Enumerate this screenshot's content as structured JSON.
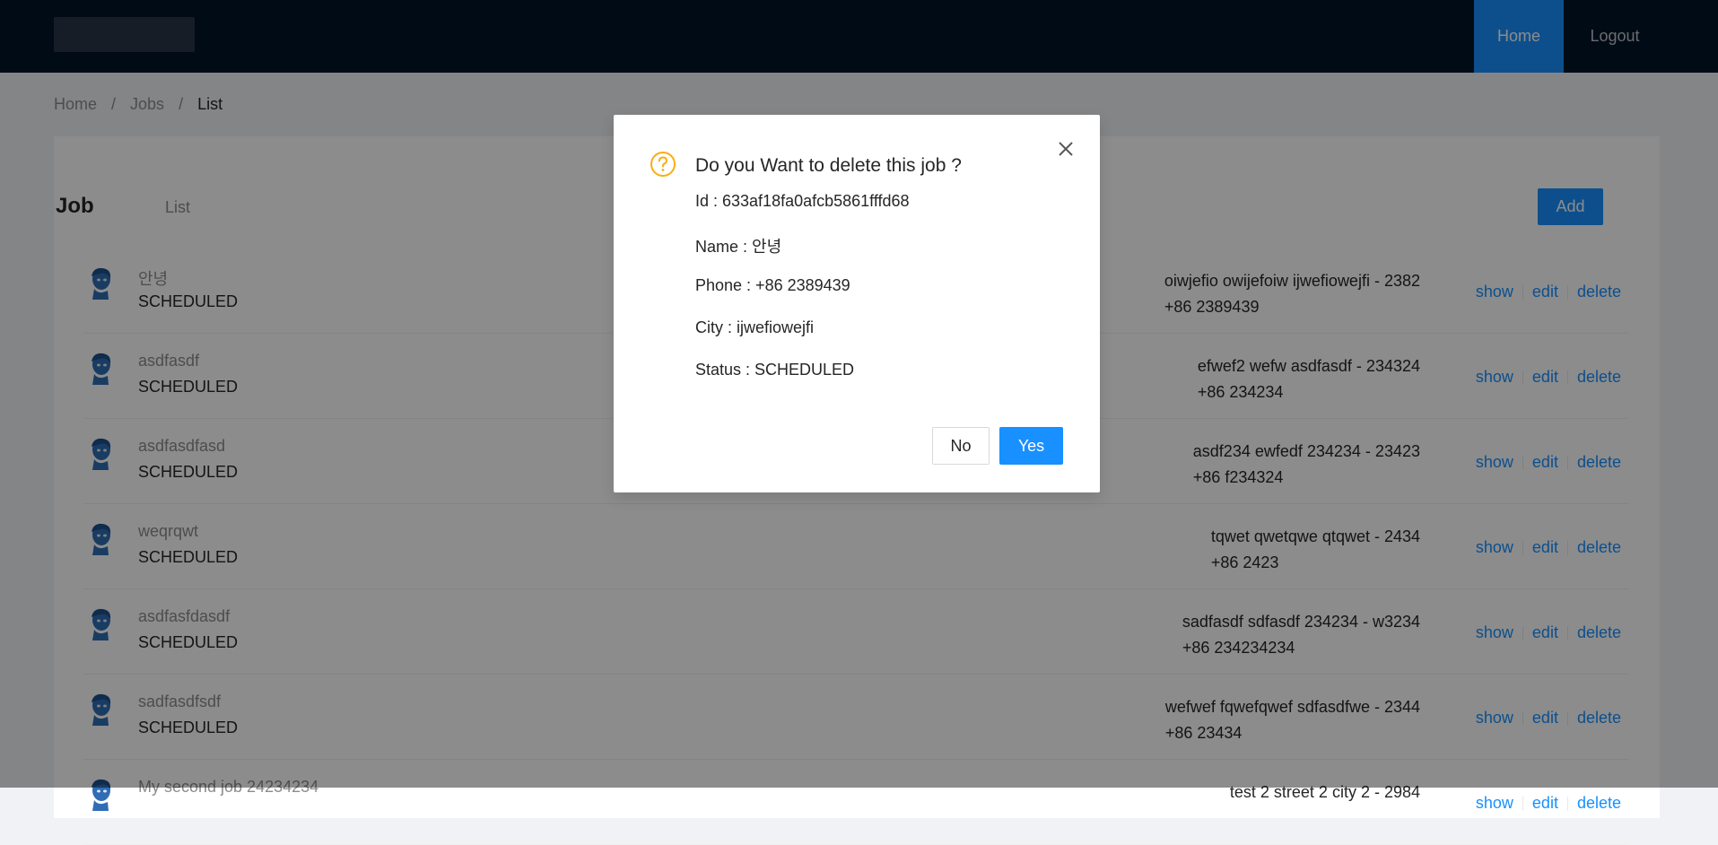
{
  "header": {
    "nav": [
      {
        "label": "Home",
        "active": true
      },
      {
        "label": "Logout",
        "active": false
      }
    ]
  },
  "breadcrumb": [
    "Home",
    "Jobs",
    "List"
  ],
  "page": {
    "title": "Job",
    "subtitle": "List",
    "add_label": "Add"
  },
  "jobs": [
    {
      "name": "안녕",
      "status": "SCHEDULED",
      "address": "oiwjefio owijefoiw ijwefiowejfi - 2382",
      "phone": "+86 2389439"
    },
    {
      "name": "asdfasdf",
      "status": "SCHEDULED",
      "address": "efwef2 wefw asdfasdf - 234324",
      "phone": "+86 234234"
    },
    {
      "name": "asdfasdfasd",
      "status": "SCHEDULED",
      "address": "asdf234 ewfedf 234234 - 23423",
      "phone": "+86 f234324"
    },
    {
      "name": "weqrqwt",
      "status": "SCHEDULED",
      "address": "tqwet qwetqwe qtqwet - 2434",
      "phone": "+86 2423"
    },
    {
      "name": "asdfasfdasdf",
      "status": "SCHEDULED",
      "address": "sadfasdf sdfasdf 234234 - w3234",
      "phone": "+86 234234234"
    },
    {
      "name": "sadfasdfsdf",
      "status": "SCHEDULED",
      "address": "wefwef fqwefqwef sdfasdfwe - 2344",
      "phone": "+86 23434"
    },
    {
      "name": "My second job 24234234",
      "status": "",
      "address": "test 2 street 2 city 2 - 2984",
      "phone": ""
    }
  ],
  "row_actions": {
    "show": "show",
    "edit": "edit",
    "delete": "delete"
  },
  "modal": {
    "title": "Do you Want to delete this job ?",
    "id_line": "Id : 633af18fa0afcb5861fffd68",
    "name_line": "Name : 안녕",
    "phone_line": "Phone : +86 2389439",
    "city_line": "City : ijwefiowejfi",
    "status_line": "Status : SCHEDULED",
    "no_label": "No",
    "yes_label": "Yes"
  },
  "colors": {
    "header_bg": "#001529",
    "primary": "#1890ff",
    "warning": "#faad14",
    "mask": "rgba(0,0,0,0.45)"
  },
  "icons": [
    "avatar-icon",
    "question-circle-icon",
    "close-icon"
  ]
}
